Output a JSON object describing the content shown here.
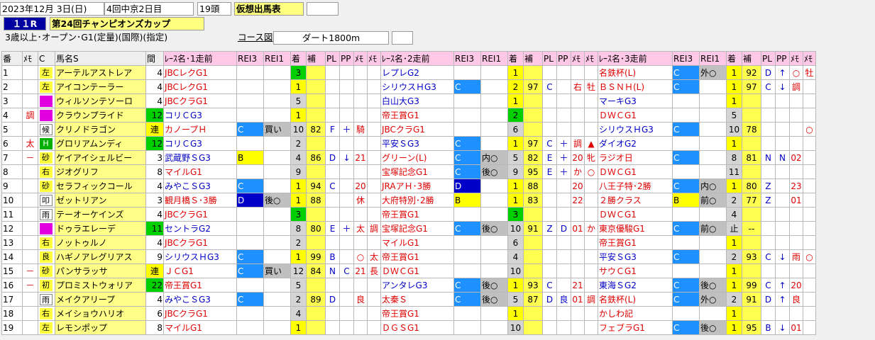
{
  "header": {
    "date": "2023年12月 3日(日)",
    "meeting": "4回中京2日目",
    "heads": "19頭",
    "title": "仮想出馬表",
    "race_no": "１１R",
    "race_name": "第24回チャンピオンズカップ",
    "conditions": "3歳以上･オープン･G1(定量)(国際)(指定)",
    "course_label": "コース図",
    "distance": "ダート1800m"
  },
  "columns": {
    "no": "番",
    "memo": "ﾒﾓ",
    "c": "C",
    "name": "馬名S",
    "kan": "間",
    "r1": "ﾚｰｽ名･1走前",
    "r2": "ﾚｰｽ名･2走前",
    "r3": "ﾚｰｽ名･3走前",
    "rei3": "REI3",
    "rei1": "REI1",
    "chaku": "着",
    "ho": "補",
    "pl": "PL",
    "pp": "PP",
    "m": "ﾒﾓ",
    "m2": "ﾒﾓ"
  },
  "rows": [
    {
      "no": "1",
      "mark": "",
      "c": "左",
      "cc": "y",
      "name": "アーテルアストレア",
      "kan": "4",
      "r1": [
        "JBCレクG1",
        "red",
        "",
        "",
        "",
        "3",
        "",
        "",
        "",
        "",
        ""
      ],
      "r1c": "g",
      "r2": [
        "レプレG2",
        "blu",
        "",
        "",
        "",
        "1",
        "",
        "",
        "",
        "",
        ""
      ],
      "r2c": "y",
      "r3": [
        "名鉄杯(L)",
        "red",
        "C",
        "外○",
        "",
        "1",
        "92",
        "D",
        "↑",
        "○",
        "牡"
      ],
      "r3c": "y"
    },
    {
      "no": "2",
      "mark": "",
      "c": "左",
      "cc": "y",
      "name": "アイコンテーラー",
      "kan": "4",
      "r1": [
        "JBCレクG1",
        "red",
        "",
        "",
        "",
        "1",
        "",
        "",
        "",
        "",
        ""
      ],
      "r1c": "y",
      "r2": [
        "シリウスＨG3",
        "blu",
        "C",
        "",
        "",
        "2",
        "97",
        "C",
        "",
        "右",
        "牡"
      ],
      "r2c": "y",
      "r3": [
        "ＢＳＮＨ(L)",
        "red",
        "C",
        "",
        "",
        "1",
        "97",
        "C",
        "↓",
        "調",
        ""
      ],
      "r3c": "y"
    },
    {
      "no": "3",
      "mark": "",
      "c": "",
      "cc": "p",
      "name": "ウィルソンテソーロ",
      "kan": "4",
      "r1": [
        "JBCクラG1",
        "red",
        "",
        "",
        "",
        "5",
        "",
        "",
        "",
        "",
        ""
      ],
      "r1c": "gy",
      "r2": [
        "白山大G3",
        "blu",
        "",
        "",
        "",
        "1",
        "",
        "",
        "",
        "",
        ""
      ],
      "r2c": "y",
      "r3": [
        "マーキG3",
        "blu",
        "",
        "",
        "",
        "1",
        "",
        "",
        "",
        "",
        ""
      ],
      "r3c": "y"
    },
    {
      "no": "4",
      "mark": "調",
      "c": "",
      "cc": "p",
      "name": "クラウンプライド",
      "kan": "12",
      "r1": [
        "コリＣG3",
        "blu",
        "",
        "",
        "",
        "1",
        "",
        "",
        "",
        "",
        ""
      ],
      "r1c": "y",
      "kanc": "g",
      "r2": [
        "帝王賞G1",
        "red",
        "",
        "",
        "",
        "2",
        "",
        "",
        "",
        "",
        ""
      ],
      "r2c": "g",
      "r3": [
        "ＤＷＣG1",
        "red",
        "",
        "",
        "",
        "5",
        "",
        "",
        "",
        "",
        ""
      ],
      "r3c": "gy"
    },
    {
      "no": "5",
      "mark": "",
      "c": "候",
      "cc": "",
      "name": "クリノドラゴン",
      "kan": "連",
      "r1": [
        "カノープＨ",
        "red",
        "C",
        "買い",
        "",
        "10",
        "82",
        "F",
        "＋",
        "騎",
        ""
      ],
      "r1c": "gy",
      "kanc": "y",
      "r2": [
        "JBCクラG1",
        "red",
        "",
        "",
        "",
        "6",
        "",
        "",
        "",
        "",
        ""
      ],
      "r2c": "gy",
      "r3": [
        "シリウスＨG3",
        "blu",
        "C",
        "",
        "",
        "10",
        "78",
        "",
        "",
        "",
        "○"
      ],
      "r3c": "gy"
    },
    {
      "no": "6",
      "mark": "太",
      "c": "H",
      "cc": "gn",
      "name": "グロリアムンディ",
      "kan": "12",
      "r1": [
        "コリＣG3",
        "blu",
        "",
        "",
        "",
        "2",
        "",
        "",
        "",
        "",
        ""
      ],
      "r1c": "gy",
      "kanc": "g",
      "r2": [
        "平安ＳG3",
        "blu",
        "C",
        "",
        "",
        "1",
        "97",
        "C",
        "＋",
        "調",
        "▲"
      ],
      "r2c": "y",
      "r3": [
        "ダイオG2",
        "blu",
        "",
        "",
        "",
        "1",
        "",
        "",
        "",
        "",
        ""
      ],
      "r3c": "y"
    },
    {
      "no": "7",
      "mark": "－",
      "c": "砂",
      "cc": "y",
      "name": "ケイアイシェルビー",
      "kan": "3",
      "r1": [
        "武蔵野ＳG3",
        "blu",
        "B",
        "",
        "",
        "4",
        "86",
        "D",
        "↓",
        "21",
        ""
      ],
      "r1c": "gy",
      "r2": [
        "グリーン(L)",
        "red",
        "C",
        "内○",
        "",
        "5",
        "82",
        "E",
        "＋",
        "20",
        "牝"
      ],
      "r2c": "gy",
      "r3": [
        "ラジオ日",
        "red",
        "C",
        "",
        "",
        "8",
        "81",
        "N",
        "N",
        "02",
        ""
      ],
      "r3c": "gy"
    },
    {
      "no": "8",
      "mark": "",
      "c": "右",
      "cc": "y",
      "name": "ジオグリフ",
      "kan": "8",
      "r1": [
        "マイルG1",
        "red",
        "",
        "",
        "",
        "9",
        "",
        "",
        "",
        "",
        ""
      ],
      "r1c": "gy",
      "r2": [
        "宝塚記念G1",
        "red",
        "C",
        "後○",
        "",
        "9",
        "95",
        "E",
        "＋",
        "か",
        "○"
      ],
      "r2c": "gy",
      "r3": [
        "ＤＷＣG1",
        "red",
        "",
        "",
        "",
        "11",
        "",
        "",
        "",
        "",
        ""
      ],
      "r3c": "gy"
    },
    {
      "no": "9",
      "mark": "",
      "c": "砂",
      "cc": "y",
      "name": "セラフィックコール",
      "kan": "4",
      "r1": [
        "みやこＳG3",
        "blu",
        "C",
        "",
        "",
        "1",
        "94",
        "C",
        "",
        "20",
        ""
      ],
      "r1c": "y",
      "r2": [
        "JRAアＨ･3勝",
        "red",
        "D",
        "",
        "",
        "1",
        "88",
        "",
        "",
        "20",
        ""
      ],
      "r2c": "y",
      "r3": [
        "八王子特･2勝",
        "red",
        "C",
        "内○",
        "",
        "1",
        "80",
        "Z",
        "",
        "23",
        ""
      ],
      "r3c": "y"
    },
    {
      "no": "10",
      "mark": "",
      "c": "叩",
      "cc": "",
      "name": "ゼットリアン",
      "kan": "3",
      "r1": [
        "観月橋Ｓ･3勝",
        "red",
        "D",
        "後○",
        "",
        "1",
        "88",
        "",
        "",
        "休",
        ""
      ],
      "r1c": "y",
      "r2": [
        "大府特別･2勝",
        "red",
        "B",
        "",
        "",
        "1",
        "83",
        "",
        "",
        "22",
        ""
      ],
      "r2c": "y",
      "r3": [
        "２勝クラス",
        "red",
        "B",
        "前○",
        "",
        "2",
        "77",
        "Z",
        "",
        "01",
        ""
      ],
      "r3c": "gy"
    },
    {
      "no": "11",
      "mark": "",
      "c": "雨",
      "cc": "",
      "name": "テーオーケインズ",
      "kan": "4",
      "r1": [
        "JBCクラG1",
        "red",
        "",
        "",
        "",
        "3",
        "",
        "",
        "",
        "",
        ""
      ],
      "r1c": "g",
      "r2": [
        "帝王賞G1",
        "red",
        "",
        "",
        "",
        "3",
        "",
        "",
        "",
        "",
        ""
      ],
      "r2c": "g",
      "r3": [
        "ＤＷＣG1",
        "red",
        "",
        "",
        "",
        "4",
        "",
        "",
        "",
        "",
        ""
      ],
      "r3c": "gy"
    },
    {
      "no": "12",
      "mark": "",
      "c": "",
      "cc": "p",
      "name": "ドゥラエレーデ",
      "kan": "11",
      "r1": [
        "セントラG2",
        "blu",
        "",
        "",
        "",
        "8",
        "80",
        "E",
        "＋",
        "太",
        "調"
      ],
      "r1c": "gy",
      "kanc": "g",
      "r2": [
        "宝塚記念G1",
        "red",
        "C",
        "後○",
        "",
        "10",
        "91",
        "Z",
        "D",
        "01",
        "か"
      ],
      "r2c": "gy",
      "r3": [
        "東京優駿G1",
        "red",
        "C",
        "前○",
        "",
        "止",
        "--",
        "",
        "",
        "",
        ""
      ],
      "r3c": "gy"
    },
    {
      "no": "13",
      "mark": "",
      "c": "右",
      "cc": "y",
      "name": "ノットゥルノ",
      "kan": "4",
      "r1": [
        "JBCクラG1",
        "red",
        "",
        "",
        "",
        "2",
        "",
        "",
        "",
        "",
        ""
      ],
      "r1c": "gy",
      "r2": [
        "マイルG1",
        "red",
        "",
        "",
        "",
        "6",
        "",
        "",
        "",
        "",
        ""
      ],
      "r2c": "gy",
      "r3": [
        "帝王賞G1",
        "red",
        "",
        "",
        "",
        "1",
        "",
        "",
        "",
        "",
        ""
      ],
      "r3c": "y"
    },
    {
      "no": "14",
      "mark": "",
      "c": "良",
      "cc": "y",
      "name": "ハギノアレグリアス",
      "kan": "9",
      "r1": [
        "シリウスＨG3",
        "blu",
        "C",
        "",
        "",
        "1",
        "99",
        "B",
        "",
        "○",
        "太"
      ],
      "r1c": "y",
      "r2": [
        "帝王賞G1",
        "red",
        "",
        "",
        "",
        "4",
        "",
        "",
        "",
        "",
        ""
      ],
      "r2c": "gy",
      "r3": [
        "平安ＳG3",
        "blu",
        "C",
        "",
        "",
        "2",
        "93",
        "C",
        "↓",
        "雨",
        "○"
      ],
      "r3c": "gy"
    },
    {
      "no": "15",
      "mark": "－",
      "c": "砂",
      "cc": "y",
      "name": "パンサラッサ",
      "kan": "連",
      "r1": [
        "ＪＣG1",
        "red",
        "C",
        "買い",
        "",
        "12",
        "84",
        "N",
        "C",
        "21",
        "長"
      ],
      "r1c": "gy",
      "kanc": "y",
      "r2": [
        "ＤＷＣG1",
        "red",
        "",
        "",
        "",
        "10",
        "",
        "",
        "",
        "",
        ""
      ],
      "r2c": "gy",
      "r3": [
        "サウＣG1",
        "red",
        "",
        "",
        "",
        "1",
        "",
        "",
        "",
        "",
        ""
      ],
      "r3c": "y"
    },
    {
      "no": "16",
      "mark": "－",
      "c": "初",
      "cc": "y",
      "name": "プロミストウォリア",
      "kan": "22",
      "r1": [
        "帝王賞G1",
        "red",
        "",
        "",
        "",
        "5",
        "",
        "",
        "",
        "",
        ""
      ],
      "r1c": "gy",
      "kanc": "g",
      "r2": [
        "アンタレG3",
        "blu",
        "C",
        "後○",
        "",
        "1",
        "93",
        "C",
        "",
        "21",
        ""
      ],
      "r2c": "y",
      "r3": [
        "東海ＳG2",
        "blu",
        "C",
        "後○",
        "",
        "1",
        "99",
        "C",
        "↑",
        "20",
        ""
      ],
      "r3c": "y"
    },
    {
      "no": "17",
      "mark": "",
      "c": "雨",
      "cc": "",
      "name": "メイクアリープ",
      "kan": "4",
      "r1": [
        "みやこＳG3",
        "blu",
        "C",
        "",
        "",
        "2",
        "89",
        "D",
        "",
        "良",
        ""
      ],
      "r1c": "gy",
      "r2": [
        "太秦Ｓ",
        "red",
        "C",
        "後○",
        "",
        "5",
        "87",
        "D",
        "良",
        "01",
        "調"
      ],
      "r2c": "gy",
      "r3": [
        "名鉄杯(L)",
        "red",
        "C",
        "外○",
        "",
        "2",
        "91",
        "D",
        "↑",
        "良",
        ""
      ],
      "r3c": "gy"
    },
    {
      "no": "18",
      "mark": "",
      "c": "右",
      "cc": "y",
      "name": "メイショウハリオ",
      "kan": "6",
      "r1": [
        "JBCクラG1",
        "red",
        "",
        "",
        "",
        "4",
        "",
        "",
        "",
        "",
        ""
      ],
      "r1c": "gy",
      "r2": [
        "帝王賞G1",
        "red",
        "",
        "",
        "",
        "1",
        "",
        "",
        "",
        "",
        ""
      ],
      "r2c": "y",
      "r3": [
        "かしわ記",
        "red",
        "",
        "",
        "",
        "1",
        "",
        "",
        "",
        "",
        ""
      ],
      "r3c": "y"
    },
    {
      "no": "19",
      "mark": "",
      "c": "左",
      "cc": "y",
      "name": "レモンポップ",
      "kan": "8",
      "r1": [
        "マイルG1",
        "red",
        "",
        "",
        "",
        "1",
        "",
        "",
        "",
        "",
        ""
      ],
      "r1c": "y",
      "r2": [
        "ＤＧＳG1",
        "red",
        "",
        "",
        "",
        "10",
        "",
        "",
        "",
        "",
        ""
      ],
      "r2c": "gy",
      "r3": [
        "フェブラG1",
        "red",
        "C",
        "後○",
        "",
        "1",
        "95",
        "B",
        "↓",
        "01",
        ""
      ],
      "r3c": "y"
    }
  ]
}
